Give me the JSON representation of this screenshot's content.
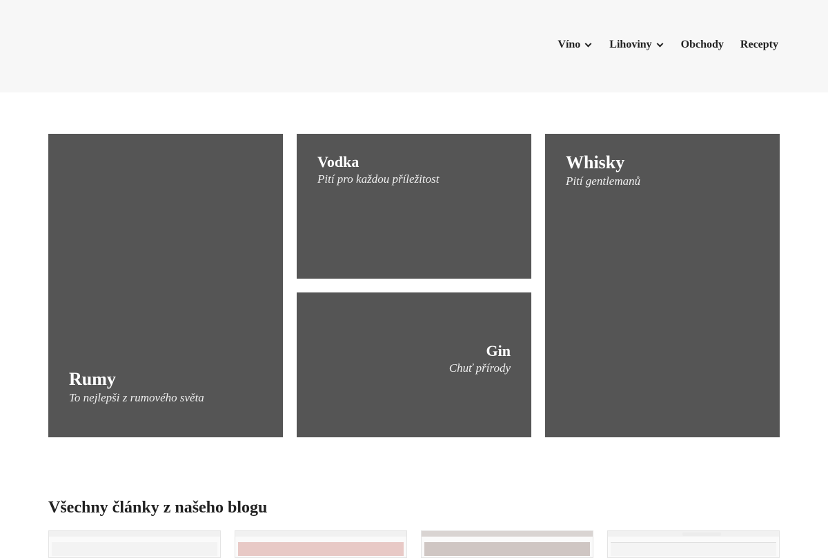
{
  "nav": {
    "items": [
      {
        "label": "Víno",
        "has_dropdown": true
      },
      {
        "label": "Lihoviny",
        "has_dropdown": true
      },
      {
        "label": "Obchody",
        "has_dropdown": false
      },
      {
        "label": "Recepty",
        "has_dropdown": false
      }
    ]
  },
  "categories": {
    "rumy": {
      "title": "Rumy",
      "subtitle": "To nejlepši z rumového světa"
    },
    "vodka": {
      "title": "Vodka",
      "subtitle": "Pití pro každou příležitost"
    },
    "gin": {
      "title": "Gin",
      "subtitle": "Chuť přírody"
    },
    "whisky": {
      "title": "Whisky",
      "subtitle": "Pití gentlemanů"
    }
  },
  "blog": {
    "heading": "Všechny články z našeho blogu"
  },
  "colors": {
    "header_bg": "#f7f7f7",
    "tile_bg": "#555555",
    "text": "#222222"
  }
}
